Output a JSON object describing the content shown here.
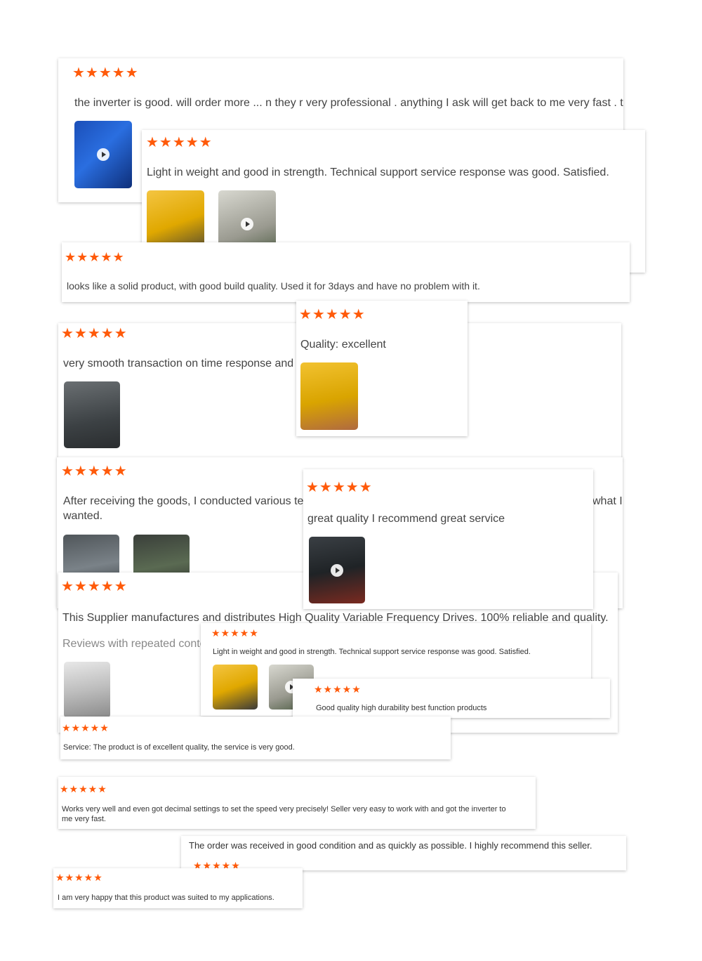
{
  "star_color": "#ff5a0a",
  "reviews": [
    {
      "stars": "★★★★★",
      "text": "the inverter is good. will order more ... n they r very professional . anything I ask will get back to me very fast . thx"
    },
    {
      "stars": "★★★★★",
      "text": "Light in weight and good in strength. Technical support service response was good. Satisfied."
    },
    {
      "stars": "★★★★★",
      "text": "looks like a solid product, with good build quality. Used it for 3days and have no problem with it."
    },
    {
      "stars": "★★★★★",
      "text": "Quality: excellent"
    },
    {
      "stars": "★★★★★",
      "text": "very smooth transaction on time response and qu"
    },
    {
      "stars": "★★★★★",
      "text": "After receiving the goods, I conducted various tests",
      "text_end": "what I",
      "text_line2": "wanted."
    },
    {
      "stars": "★★★★★",
      "text": "great quality I recommend great service"
    },
    {
      "stars": "★★★★★",
      "text": "This Supplier manufactures and distributes High Quality Variable Frequency Drives. 100% reliable and quality.",
      "subtext": "Reviews with repeated conter"
    },
    {
      "stars": "★★★★★",
      "text": "Light in weight and good in strength. Technical support service response was good. Satisfied."
    },
    {
      "stars": "★★★★★",
      "text": "Good quality high durability best function products"
    },
    {
      "stars": "★★★★★",
      "text": "Service: The product is of excellent quality, the service is very good."
    },
    {
      "stars": "★★★★★",
      "text": "Works very well and even got decimal settings to set the speed very precisely! Seller very easy to work with and got the inverter to me very fast."
    },
    {
      "stars": "★★★★★",
      "text": "The order was received in good condition and as quickly as possible. I highly recommend this seller."
    },
    {
      "stars": "★★★★★",
      "text": "I am very happy that this product was suited to my applications."
    }
  ]
}
